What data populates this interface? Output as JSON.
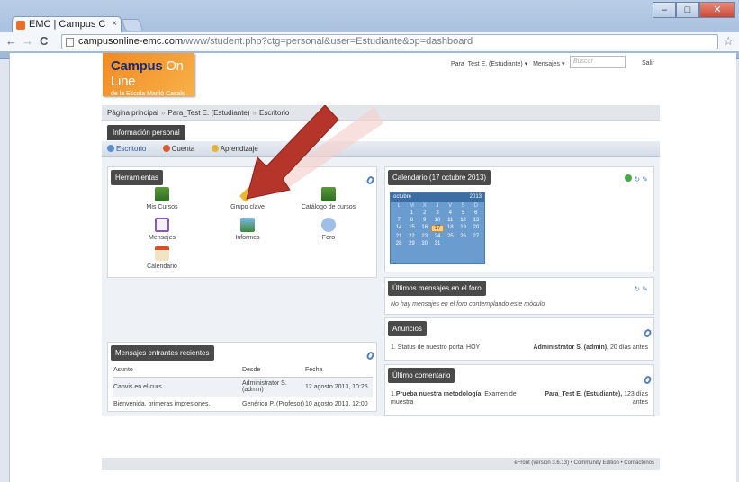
{
  "browser": {
    "tab_title": "EMC | Campus C",
    "url_host": "campusonline-emc.com",
    "url_path": "/www/student.php?ctg=personal&user=Estudiante&op=dashboard"
  },
  "header": {
    "logo_line1a": "Campus",
    "logo_line1b": "On Line",
    "logo_line2": "de la Escola Mariló Casals",
    "user_menu": "Para_Test E. (Estudiante) ▾",
    "messages_menu": "Mensajes ▾",
    "search_placeholder": "Buscar",
    "logout": "Salir"
  },
  "breadcrumb": {
    "home": "Página principal",
    "user": "Para_Test E. (Estudiante)",
    "current": "Escritorio"
  },
  "section": {
    "title": "Información personal"
  },
  "tabs": [
    "Escritorio",
    "Cuenta",
    "Aprendizaje"
  ],
  "tools": {
    "title": "Herramientas",
    "items": [
      "Mis Cursos",
      "Grupo clave",
      "Catálogo de cursos",
      "Mensajes",
      "Informes",
      "Foro",
      "Calendario"
    ]
  },
  "inbox": {
    "title": "Mensajes entrantes recientes",
    "headers": [
      "Asunto",
      "Desde",
      "Fecha"
    ],
    "rows": [
      [
        "Canvis en el curs.",
        "Administrator S. (admin)",
        "12 agosto 2013, 10:25"
      ],
      [
        "Bienvenida, primeras impresiones.",
        "Genérico P. (Profesor)",
        "10 agosto 2013, 12:00"
      ]
    ]
  },
  "calendar": {
    "title": "Calendario (17 octubre 2013)",
    "month": "octubre",
    "year": "2013",
    "day_headers": [
      "L",
      "M",
      "X",
      "J",
      "V",
      "S",
      "D"
    ],
    "days": [
      "",
      "1",
      "2",
      "3",
      "4",
      "5",
      "6",
      "7",
      "8",
      "9",
      "10",
      "11",
      "12",
      "13",
      "14",
      "15",
      "16",
      "17",
      "18",
      "19",
      "20",
      "21",
      "22",
      "23",
      "24",
      "25",
      "26",
      "27",
      "28",
      "29",
      "30",
      "31",
      "",
      "",
      ""
    ],
    "today": "17"
  },
  "forum": {
    "title": "Últimos mensajes en el foro",
    "empty": "No hay mensajes en el foro contemplando este módulo"
  },
  "news": {
    "title": "Anuncios",
    "item": "1. Status de nuestro portal HOY",
    "author": "Administrator S. (admin),",
    "when": "20 días antes"
  },
  "comment": {
    "title": "Último comentario",
    "num": "1.",
    "bold": "Prueba nuestra metodología",
    "rest": ": Examen de muestra",
    "author": "Para_Test E. (Estudiante),",
    "when": "123 días antes"
  },
  "footer": {
    "text": "eFront (version 3.6.13) • Community Edition • Contáctenos"
  },
  "colors": {
    "accent": "#4a4a4a",
    "arrow": "#b5352a"
  }
}
